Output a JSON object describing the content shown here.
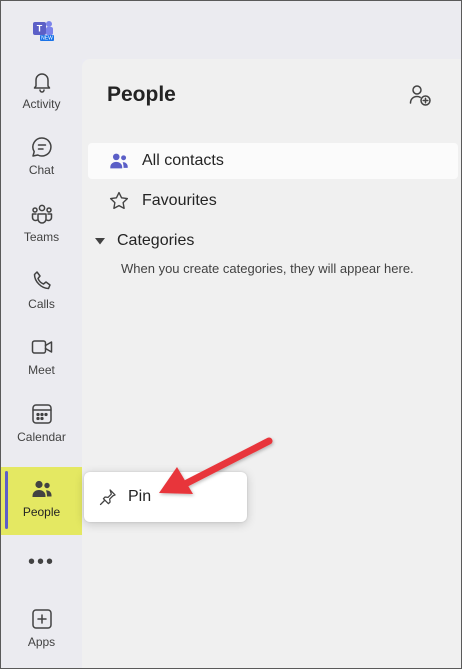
{
  "app": {
    "logo_badge": "NEW"
  },
  "rail": {
    "items": [
      {
        "label": "Activity",
        "icon": "bell-icon"
      },
      {
        "label": "Chat",
        "icon": "chat-icon"
      },
      {
        "label": "Teams",
        "icon": "teams-icon"
      },
      {
        "label": "Calls",
        "icon": "phone-icon"
      },
      {
        "label": "Meet",
        "icon": "video-icon"
      },
      {
        "label": "Calendar",
        "icon": "calendar-icon"
      },
      {
        "label": "People",
        "icon": "people-icon",
        "active": true
      },
      {
        "label": "Apps",
        "icon": "add-app-icon"
      }
    ],
    "more_label": "•••"
  },
  "main": {
    "title": "People",
    "nav": [
      {
        "label": "All contacts",
        "icon": "contacts-icon",
        "selected": true
      },
      {
        "label": "Favourites",
        "icon": "star-icon"
      }
    ],
    "categories": {
      "label": "Categories",
      "empty_note": "When you create categories, they will appear here."
    }
  },
  "context_menu": {
    "items": [
      {
        "label": "Pin",
        "icon": "pin-icon"
      }
    ]
  },
  "colors": {
    "accent": "#5b5fc7",
    "highlight": "#e4e862",
    "annotation_arrow": "#e8363b"
  }
}
